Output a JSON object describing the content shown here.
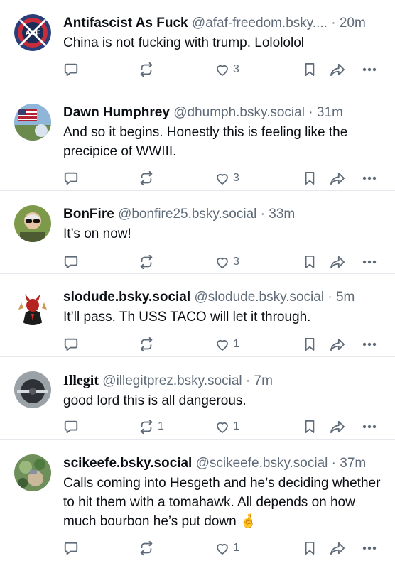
{
  "colors": {
    "text": "#0b0f14",
    "muted": "#5f6b78",
    "divider": "#e5e9ee"
  },
  "icons": {
    "reply": "reply-bubble-icon",
    "repost": "repost-icon",
    "like": "heart-icon",
    "bookmark": "bookmark-icon",
    "share": "share-arrow-icon",
    "more": "more-dots-icon"
  },
  "posts": [
    {
      "name": "Antifascist As Fuck",
      "handle": "@afaf-freedom.bsky....",
      "dot": "·",
      "time": "20m",
      "text": "China is not fucking with trump. Lolololol",
      "reposts": "",
      "likes": "3",
      "avatar": "afaf-logo-avatar",
      "avatar_text": "AFF"
    },
    {
      "name": "Dawn Humphrey",
      "handle": "@dhumph.bsky.social",
      "dot": "·",
      "time": "31m",
      "text": "And so it begins. Honestly this is feeling like the precipice of WWIII.",
      "reposts": "",
      "likes": "3",
      "avatar": "flag-photo-avatar"
    },
    {
      "name": "BonFire",
      "handle": "@bonfire25.bsky.social",
      "dot": "·",
      "time": "33m",
      "text": "It’s on now!",
      "reposts": "",
      "likes": "3",
      "avatar": "person-sunglasses-avatar"
    },
    {
      "name": "slodude.bsky.social",
      "handle": "@slodude.bsky.social",
      "dot": "·",
      "time": "5m",
      "text": "It’ll pass. Th USS TACO will let it through.",
      "reposts": "",
      "likes": "1",
      "avatar": "devil-suit-avatar"
    },
    {
      "name": "Illegit",
      "handle": "@illegitprez.bsky.social",
      "dot": "·",
      "time": "7m",
      "text": "good lord this is all dangerous.",
      "reposts": "1",
      "likes": "1",
      "avatar": "dark-photo-avatar"
    },
    {
      "name": "scikeefe.bsky.social",
      "handle": "@scikeefe.bsky.social",
      "dot": "·",
      "time": "37m",
      "text": "Calls coming into Hesgeth and he’s deciding whether to hit them with a tomahawk. All depends on how much bourbon he’s put down 🤞",
      "reposts": "",
      "likes": "1",
      "avatar": "garden-photo-avatar"
    }
  ]
}
